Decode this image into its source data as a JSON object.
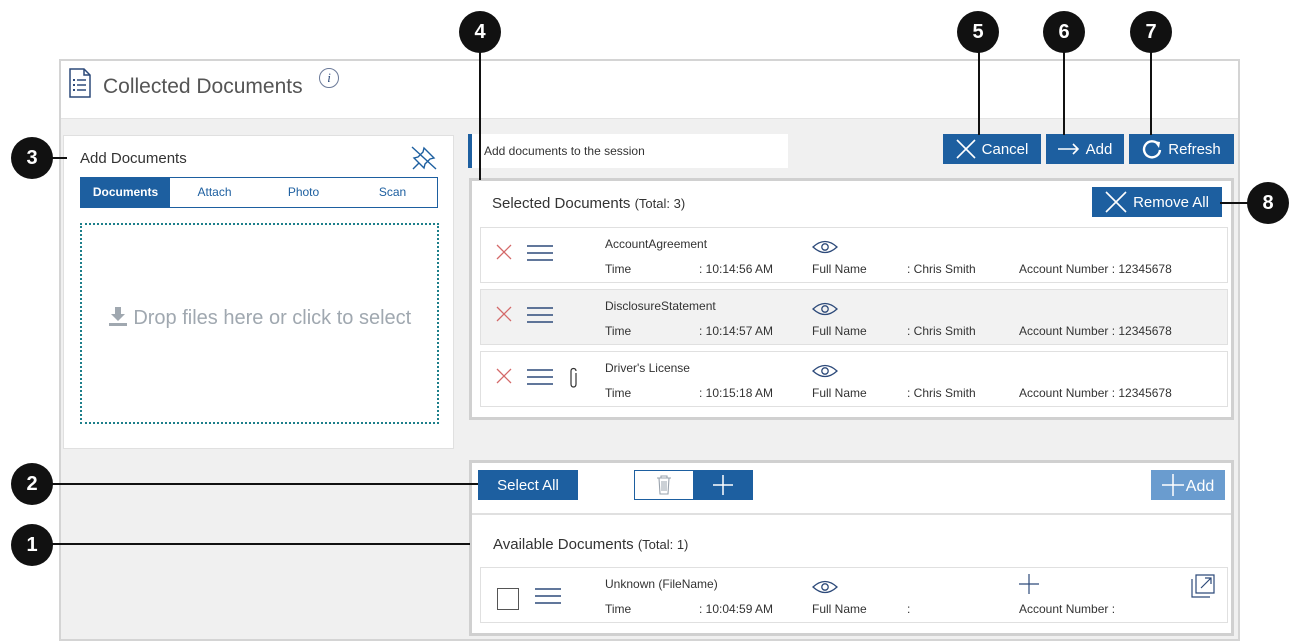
{
  "header": {
    "title": "Collected Documents",
    "info": "i"
  },
  "callouts": [
    "1",
    "2",
    "3",
    "4",
    "5",
    "6",
    "7",
    "8"
  ],
  "add_documents": {
    "title": "Add Documents",
    "tabs": [
      "Documents",
      "Attach",
      "Photo",
      "Scan"
    ],
    "active_tab": "Documents",
    "drop_text": "Drop files here or click to select"
  },
  "message": "Add documents to the session",
  "actions": {
    "cancel": "Cancel",
    "add": "Add",
    "refresh": "Refresh"
  },
  "selected": {
    "title": "Selected Documents",
    "total": "(Total: 3)",
    "remove_all": "Remove All",
    "rows": [
      {
        "name": "AccountAgreement",
        "time_label": "Time",
        "time": ": 10:14:56 AM",
        "full_name_label": "Full Name",
        "full_name": ": Chris Smith",
        "account": "Account Number : 12345678",
        "attachment": false
      },
      {
        "name": "DisclosureStatement",
        "time_label": "Time",
        "time": ": 10:14:57 AM",
        "full_name_label": "Full Name",
        "full_name": ": Chris Smith",
        "account": "Account Number : 12345678",
        "attachment": false
      },
      {
        "name": "Driver's License",
        "time_label": "Time",
        "time": ": 10:15:18 AM",
        "full_name_label": "Full Name",
        "full_name": ": Chris Smith",
        "account": "Account Number : 12345678",
        "attachment": true
      }
    ]
  },
  "available": {
    "select_all": "Select All",
    "add": "Add",
    "title": "Available Documents",
    "total": "(Total: 1)",
    "rows": [
      {
        "name": "Unknown (FileName)",
        "time_label": "Time",
        "time": ": 10:04:59 AM",
        "full_name_label": "Full Name",
        "full_name": ":",
        "account": "Account Number :"
      }
    ]
  },
  "colors": {
    "primary": "#1d5fa0",
    "light_button": "#6a9ccf",
    "remove_x": "#d46a6a"
  }
}
